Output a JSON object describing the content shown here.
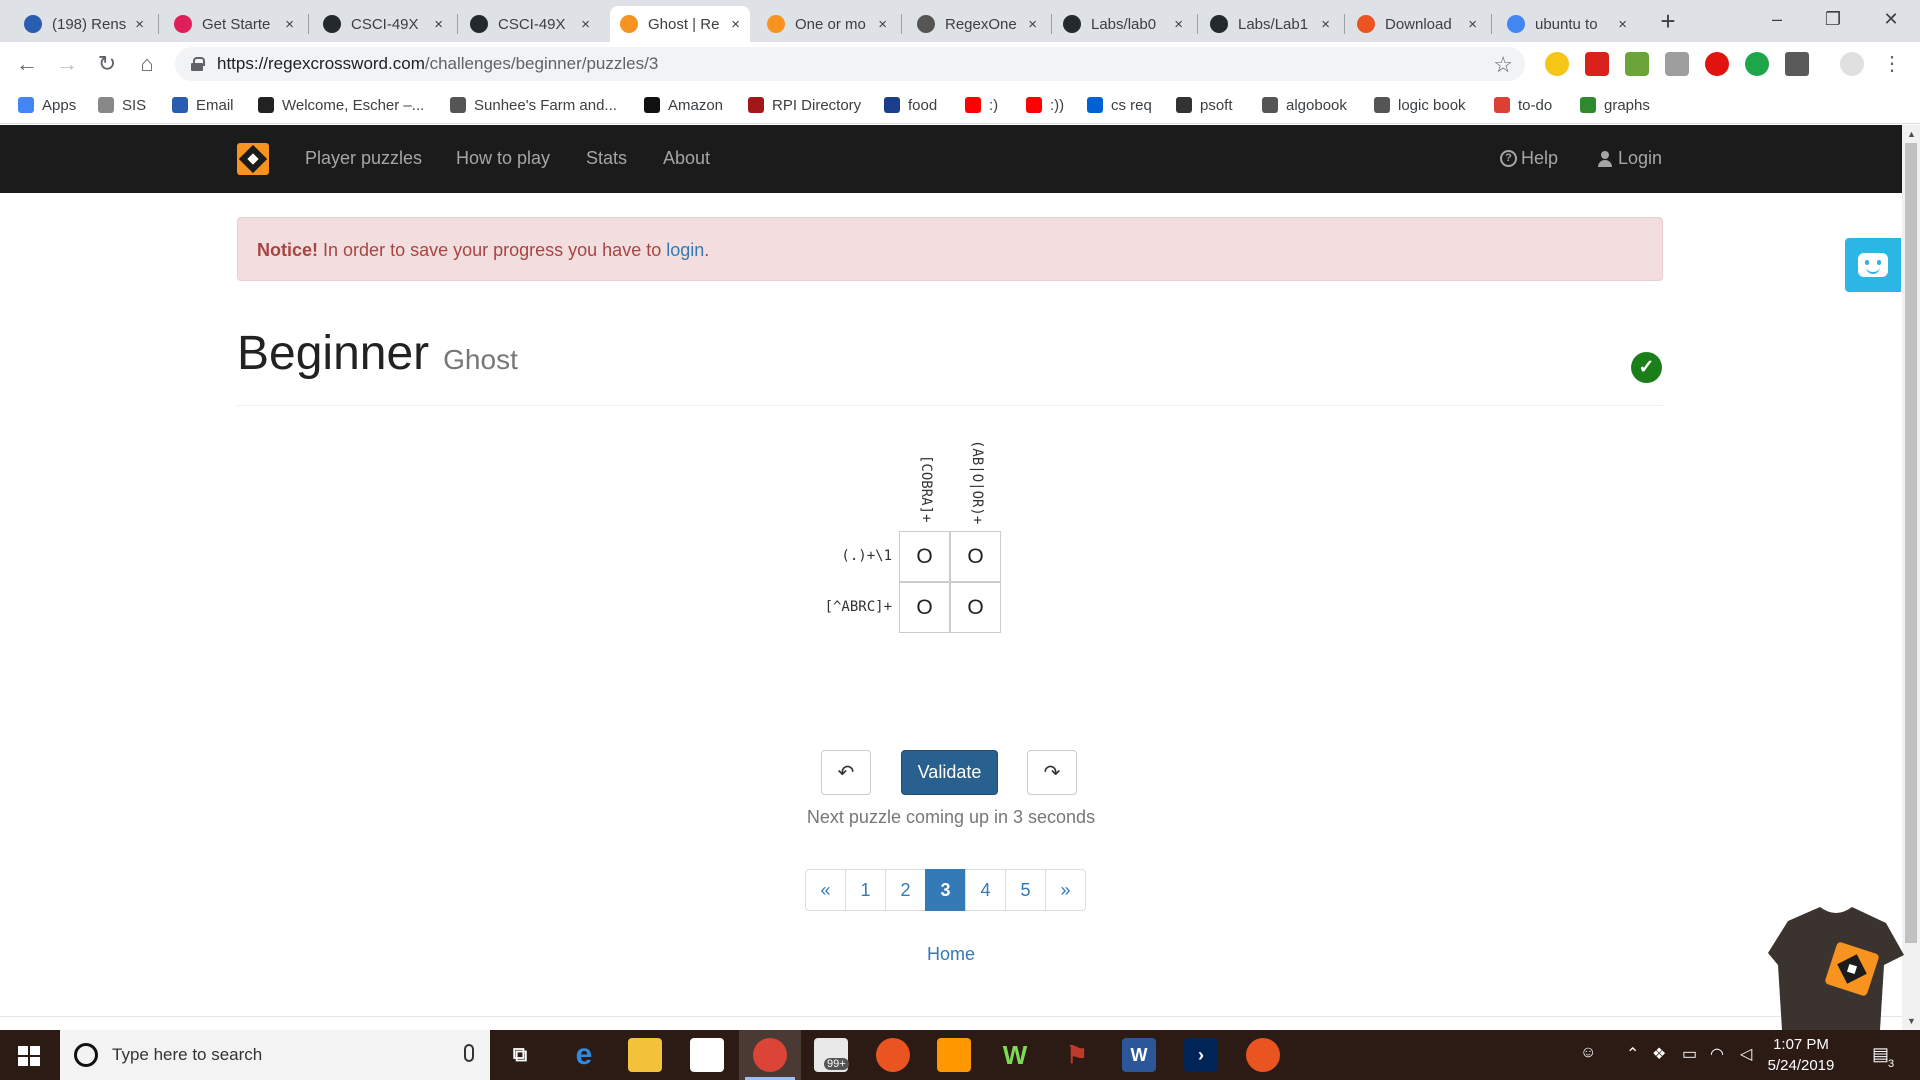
{
  "browser": {
    "tabs": [
      {
        "label": "(198) Rens",
        "icon": "globe-icon",
        "color": "#2a5db0"
      },
      {
        "label": "Get Starte",
        "icon": "slack-icon",
        "color": "#e01e5a"
      },
      {
        "label": "CSCI-49X",
        "icon": "github-icon",
        "color": "#24292e"
      },
      {
        "label": "CSCI-49X",
        "icon": "github-icon",
        "color": "#24292e"
      },
      {
        "label": "Ghost | Re",
        "icon": "regex-crossword-icon",
        "color": "#f7931e"
      },
      {
        "label": "One or mo",
        "icon": "regex-crossword-icon",
        "color": "#f7931e"
      },
      {
        "label": "RegexOne",
        "icon": "regexone-icon",
        "color": "#555555"
      },
      {
        "label": "Labs/lab0",
        "icon": "github-icon",
        "color": "#24292e"
      },
      {
        "label": "Labs/Lab1",
        "icon": "github-icon",
        "color": "#24292e"
      },
      {
        "label": "Download",
        "icon": "ubuntu-icon",
        "color": "#e95420"
      },
      {
        "label": "ubuntu to",
        "icon": "google-icon",
        "color": "#4285f4"
      }
    ],
    "close_glyph": "×",
    "new_tab_glyph": "+",
    "url_host": "https://regexcrossword.com",
    "url_path": "/challenges/beginner/puzzles/3",
    "bookmarks": [
      {
        "label": "Apps",
        "icon": "apps-grid-icon",
        "color": "#4285f4"
      },
      {
        "label": "SIS",
        "icon": "sis-icon",
        "color": "#888888"
      },
      {
        "label": "Email",
        "icon": "email-globe-icon",
        "color": "#2a5db0"
      },
      {
        "label": "Welcome, Escher –...",
        "icon": "blackboard-icon",
        "color": "#222222"
      },
      {
        "label": "Sunhee's Farm and...",
        "icon": "farm-icon",
        "color": "#555555"
      },
      {
        "label": "Amazon",
        "icon": "amazon-icon",
        "color": "#111111"
      },
      {
        "label": "RPI Directory",
        "icon": "book-icon",
        "color": "#a3161a"
      },
      {
        "label": "food",
        "icon": "grid-icon",
        "color": "#1a3e8c"
      },
      {
        "label": ":)",
        "icon": "youtube-icon",
        "color": "#ff0000"
      },
      {
        "label": ":))",
        "icon": "youtube-icon",
        "color": "#ff0000"
      },
      {
        "label": "cs req",
        "icon": "box-icon",
        "color": "#0061d5"
      },
      {
        "label": "psoft",
        "icon": "psoft-icon",
        "color": "#333333"
      },
      {
        "label": "algobook",
        "icon": "globe-icon",
        "color": "#555555"
      },
      {
        "label": "logic book",
        "icon": "globe-icon",
        "color": "#555555"
      },
      {
        "label": "to-do",
        "icon": "todo-icon",
        "color": "#db4035"
      },
      {
        "label": "graphs",
        "icon": "desmos-icon",
        "color": "#2d8a2d"
      }
    ]
  },
  "site": {
    "nav": [
      "Player puzzles",
      "How to play",
      "Stats",
      "About"
    ],
    "help": "Help",
    "login": "Login",
    "notice_strong": "Notice!",
    "notice_text": "In order to save your progress you have to",
    "notice_link": "login",
    "notice_end": ".",
    "title": "Beginner",
    "subtitle": "Ghost",
    "solved_glyph": "✓",
    "puzzle": {
      "column_clues": [
        "[COBRA]+",
        "(AB|O|OR)+"
      ],
      "row_clues": [
        "(.)+\\1",
        "[^ABRC]+"
      ],
      "cells": [
        [
          "O",
          "O"
        ],
        [
          "O",
          "O"
        ]
      ]
    },
    "undo_glyph": "↶",
    "validate": "Validate",
    "redo_glyph": "↷",
    "next_message": "Next puzzle coming up in 3 seconds",
    "pagination": [
      "«",
      "1",
      "2",
      "3",
      "4",
      "5",
      "»"
    ],
    "current_page": "3",
    "home": "Home"
  },
  "taskbar": {
    "search_placeholder": "Type here to search",
    "time": "1:07 PM",
    "date": "5/24/2019",
    "mail_badge": "99+",
    "notification_count": "3"
  },
  "colors": {
    "nav_bg": "#1b1b1b",
    "brand_orange": "#f7931e",
    "link_blue": "#337ab7",
    "primary_button": "#286090",
    "notice_bg": "#f2dede",
    "notice_text": "#a94442",
    "solved_green": "#1a7f1a",
    "chat_blue": "#2cb6e6"
  }
}
